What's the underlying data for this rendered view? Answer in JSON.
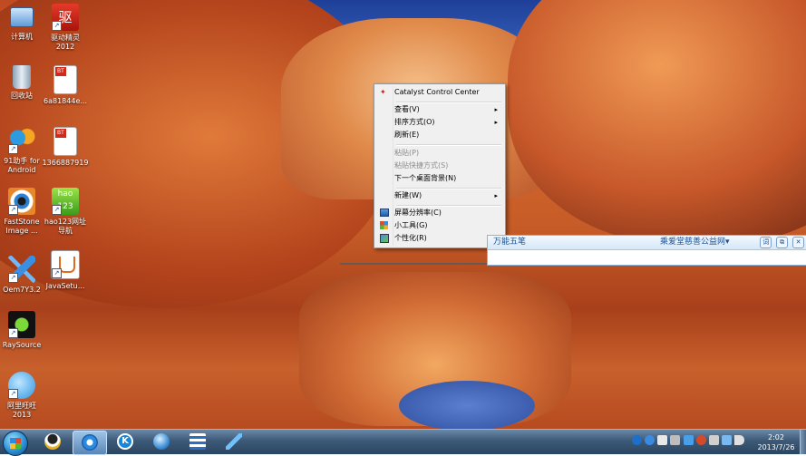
{
  "desktop_icons": [
    {
      "label": "计算机",
      "icon": "computer-icon"
    },
    {
      "label": "驱动精灵\n2012",
      "icon": "driver-genius-icon"
    },
    {
      "label": "回收站",
      "icon": "recycle-bin-icon"
    },
    {
      "label": "6a81844e...",
      "icon": "torrent-file-icon"
    },
    {
      "label": "91助手 for\nAndroid",
      "icon": "91-assistant-icon"
    },
    {
      "label": "1366887919",
      "icon": "torrent-file-icon"
    },
    {
      "label": "FastStone\nImage ...",
      "icon": "faststone-eye-icon"
    },
    {
      "label": "hao123网址\n导航",
      "icon": "hao123-icon"
    },
    {
      "label": "Oem7Y3.2",
      "icon": "oem-plane-icon"
    },
    {
      "label": "JavaSetu...",
      "icon": "java-icon"
    },
    {
      "label": "RaySource",
      "icon": "raysource-icon"
    },
    {
      "label": "阿里旺旺\n2013",
      "icon": "aliwangwang-icon"
    }
  ],
  "context_menu": {
    "header": "Catalyst Control Center",
    "items": [
      {
        "label": "查看(V)",
        "submenu": true,
        "disabled": false
      },
      {
        "label": "排序方式(O)",
        "submenu": true,
        "disabled": false
      },
      {
        "label": "刷新(E)",
        "submenu": false,
        "disabled": false
      },
      {
        "label": "粘贴(P)",
        "submenu": false,
        "disabled": true
      },
      {
        "label": "粘贴快捷方式(S)",
        "submenu": false,
        "disabled": true
      },
      {
        "label": "下一个桌面背景(N)",
        "submenu": false,
        "disabled": false
      },
      {
        "label": "新建(W)",
        "submenu": true,
        "disabled": false
      },
      {
        "label": "屏幕分辨率(C)",
        "submenu": false,
        "disabled": false
      },
      {
        "label": "小工具(G)",
        "submenu": false,
        "disabled": false
      },
      {
        "label": "个性化(R)",
        "submenu": false,
        "disabled": false
      }
    ],
    "submenu_arrow": "▸"
  },
  "ime_bar": {
    "tab_label": "万能五笔",
    "link_label": "乘爱堂慈善公益网▾",
    "buttons": [
      "词",
      "⧉",
      "✕"
    ]
  },
  "taskbar": {
    "apps": [
      "qq-penguin-icon",
      "internet-explorer-icon",
      "kugou-k-icon",
      "browser-globe-icon",
      "file-manager-icon",
      "oem-plane-icon"
    ],
    "active_app": "internet-explorer-icon",
    "clock_time": "2:02",
    "clock_date": "2013/7/26"
  },
  "colors": {
    "taskbar": "#3c5a78",
    "menu_bg": "#f0f0f0",
    "ime_accent": "#1b4f8e"
  }
}
